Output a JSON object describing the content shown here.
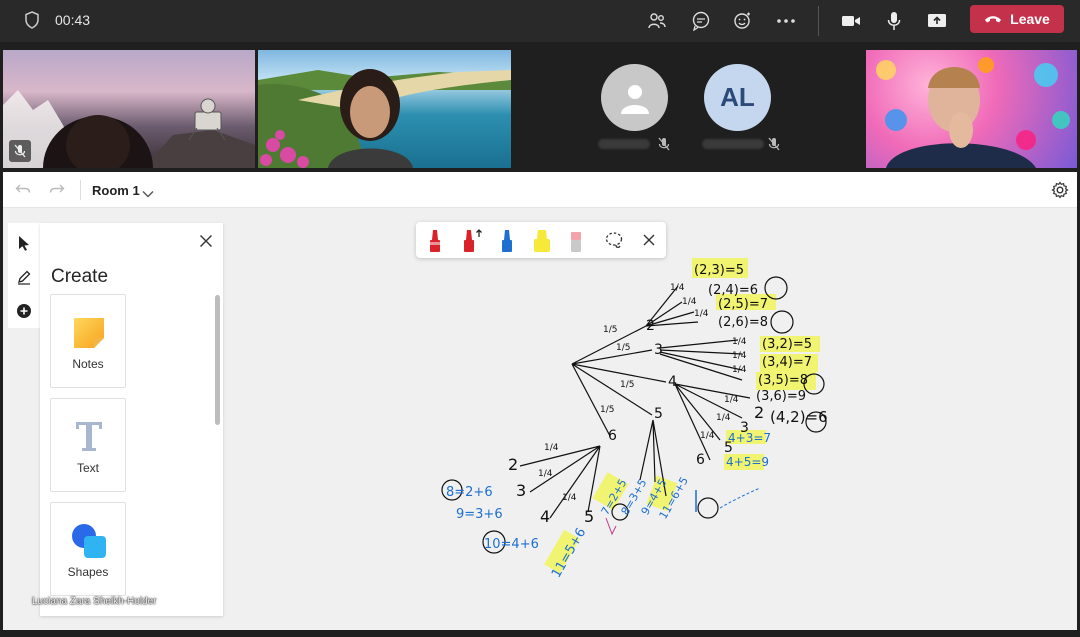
{
  "meeting": {
    "timer": "00:43",
    "leave_label": "Leave",
    "participants": [
      {
        "id": "p3",
        "initials": "AL"
      }
    ]
  },
  "whiteboard": {
    "room_name": "Room 1",
    "panel": {
      "title": "Create",
      "cards": [
        {
          "label": "Notes",
          "icon": "notes-icon"
        },
        {
          "label": "Text",
          "icon": "text-icon"
        },
        {
          "label": "Shapes",
          "icon": "shapes-icon"
        }
      ]
    }
  },
  "credit": "Luciana Zara Sheikh-Holder",
  "handwriting": {
    "top_outcomes": [
      "(2,3)=5",
      "(2,4)=6",
      "(2,5)=7",
      "(2,6)=8"
    ],
    "mid_outcomes": [
      "(3,2)=5",
      "(3,4)=7",
      "(3,5)=8",
      "(3,6)=9"
    ],
    "low_outcomes": [
      "(4,2)=6",
      "4+3=7",
      "4+5=9"
    ],
    "sums_left": [
      "8=2+6",
      "9=3+6",
      "10=4+6",
      "11=5+6"
    ],
    "sums_mid": [
      "7=2+5",
      "8=3+5",
      "9=4+5",
      "11=6+5"
    ],
    "fractions": [
      "1/5",
      "1/4"
    ],
    "numbers": [
      "2",
      "3",
      "4",
      "5",
      "6"
    ]
  },
  "colors": {
    "leave": "#c4314b",
    "topbar": "#292929",
    "canvas": "#f0f0f0",
    "highlight": "#f2f55a",
    "ink_blue": "#1d6fd0"
  }
}
